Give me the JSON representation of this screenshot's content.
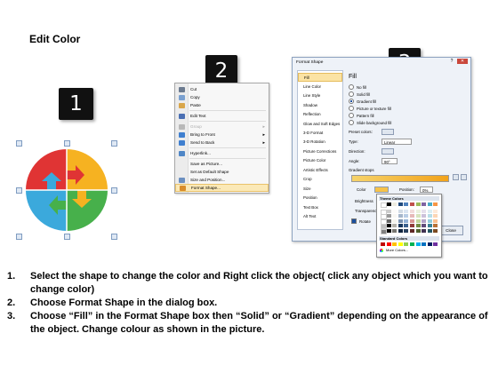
{
  "title": "Edit Color",
  "badges": [
    "1",
    "2",
    "3"
  ],
  "context_menu": {
    "items": [
      {
        "label": "Cut",
        "icon": "scissors-icon",
        "color": "#6b7a8f"
      },
      {
        "label": "Copy",
        "icon": "copy-icon",
        "color": "#7aa0d0"
      },
      {
        "label": "Paste",
        "icon": "paste-icon",
        "color": "#d9a64a"
      },
      {
        "label": "Edit Text",
        "icon": "text-icon",
        "color": "#4a6fb3"
      },
      {
        "label": "Group",
        "icon": "group-icon",
        "color": "#b8b8b8",
        "disabled": true,
        "arrow": "▸"
      },
      {
        "label": "Bring to Front",
        "icon": "bring-front-icon",
        "color": "#3f7fcf",
        "arrow": "▸"
      },
      {
        "label": "Send to Back",
        "icon": "send-back-icon",
        "color": "#3f7fcf",
        "arrow": "▸"
      },
      {
        "label": "Hyperlink...",
        "icon": "link-icon",
        "color": "#4f86c6"
      },
      {
        "label": "Save as Picture...",
        "icon": "",
        "color": ""
      },
      {
        "label": "Set as Default Shape",
        "icon": "",
        "color": ""
      },
      {
        "label": "Size and Position...",
        "icon": "size-icon",
        "color": "#6b8fc0"
      },
      {
        "label": "Format Shape...",
        "icon": "format-icon",
        "color": "#d98d2a",
        "highlighted": true
      }
    ]
  },
  "dialog": {
    "title": "Format Shape",
    "title_buttons": [
      "?",
      "✕"
    ],
    "nav": [
      "Fill",
      "Line Color",
      "Line Style",
      "Shadow",
      "Reflection",
      "Glow and Soft Edges",
      "3-D Format",
      "3-D Rotation",
      "Picture Corrections",
      "Picture Color",
      "Artistic Effects",
      "Crop",
      "Size",
      "Position",
      "Text Box",
      "Alt Text"
    ],
    "fill_heading": "Fill",
    "options": [
      "No fill",
      "Solid fill",
      "Gradient fill",
      "Picture or texture fill",
      "Pattern fill",
      "Slide background fill"
    ],
    "selected_option": "Gradient fill",
    "preset_label": "Preset colors:",
    "type_label": "Type:",
    "type_value": "Linear",
    "direction_label": "Direction:",
    "angle_label": "Angle:",
    "angle_value": "90°",
    "stops_label": "Gradient stops",
    "color_label": "Color",
    "position_label": "Position:",
    "position_value": "0%",
    "brightness_label": "Brightness",
    "transparency_label": "Transparency",
    "rotate_label": "Rotate",
    "close_label": "Close"
  },
  "palette": {
    "theme_heading": "Theme Colors",
    "standard_heading": "Standard Colors",
    "more_label": "More Colors...",
    "theme_top": [
      "#ffffff",
      "#000000",
      "#eeece1",
      "#1f497d",
      "#4f81bd",
      "#c0504d",
      "#9bbb59",
      "#8064a2",
      "#4bacc6",
      "#f79646"
    ],
    "standard": [
      "#c00000",
      "#ff0000",
      "#ffc000",
      "#ffff00",
      "#92d050",
      "#00b050",
      "#00b0f0",
      "#0070c0",
      "#002060",
      "#7030a0"
    ]
  },
  "graphic": {
    "quadrant_colors": [
      "#e03434",
      "#f6b221",
      "#3ba9dc",
      "#47b04b"
    ]
  },
  "steps": [
    {
      "num": "1.",
      "text": "Select the shape to change the color and Right click the object( click any object which you want to change color)"
    },
    {
      "num": "2.",
      "text": "Choose Format Shape in the dialog box."
    },
    {
      "num": "3.",
      "text": "Choose “Fill” in the Format Shape box then “Solid” or “Gradient” depending on the appearance of the object. Change colour as shown in the picture."
    }
  ]
}
